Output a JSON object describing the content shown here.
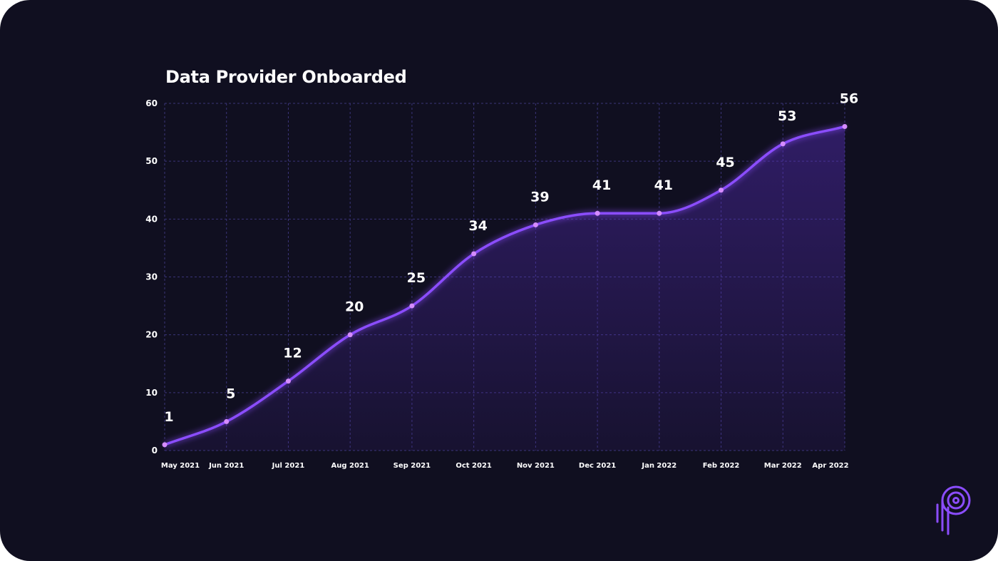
{
  "colors": {
    "background": "#100f20",
    "line": "#8b4dff",
    "point": "#d58cff",
    "grid": "#3a3478",
    "text": "#ffffff"
  },
  "logo": {
    "icon": "brand-logo-icon"
  },
  "chart_data": {
    "type": "area",
    "title": "Data Provider Onboarded",
    "xlabel": "",
    "ylabel": "",
    "categories": [
      "May 2021",
      "Jun 2021",
      "Jul 2021",
      "Aug 2021",
      "Sep 2021",
      "Oct 2021",
      "Nov 2021",
      "Dec 2021",
      "Jan 2022",
      "Feb 2022",
      "Mar 2022",
      "Apr 2022"
    ],
    "values": [
      1,
      5,
      12,
      20,
      25,
      34,
      39,
      41,
      41,
      45,
      53,
      56
    ],
    "labels": [
      "1",
      "5",
      "12",
      "20",
      "25",
      "34",
      "39",
      "41",
      "41",
      "45",
      "53",
      "56"
    ],
    "yticks": [
      "0",
      "10",
      "20",
      "30",
      "40",
      "50",
      "60"
    ],
    "ylim": [
      0,
      60
    ],
    "grid": true,
    "smooth": true
  }
}
